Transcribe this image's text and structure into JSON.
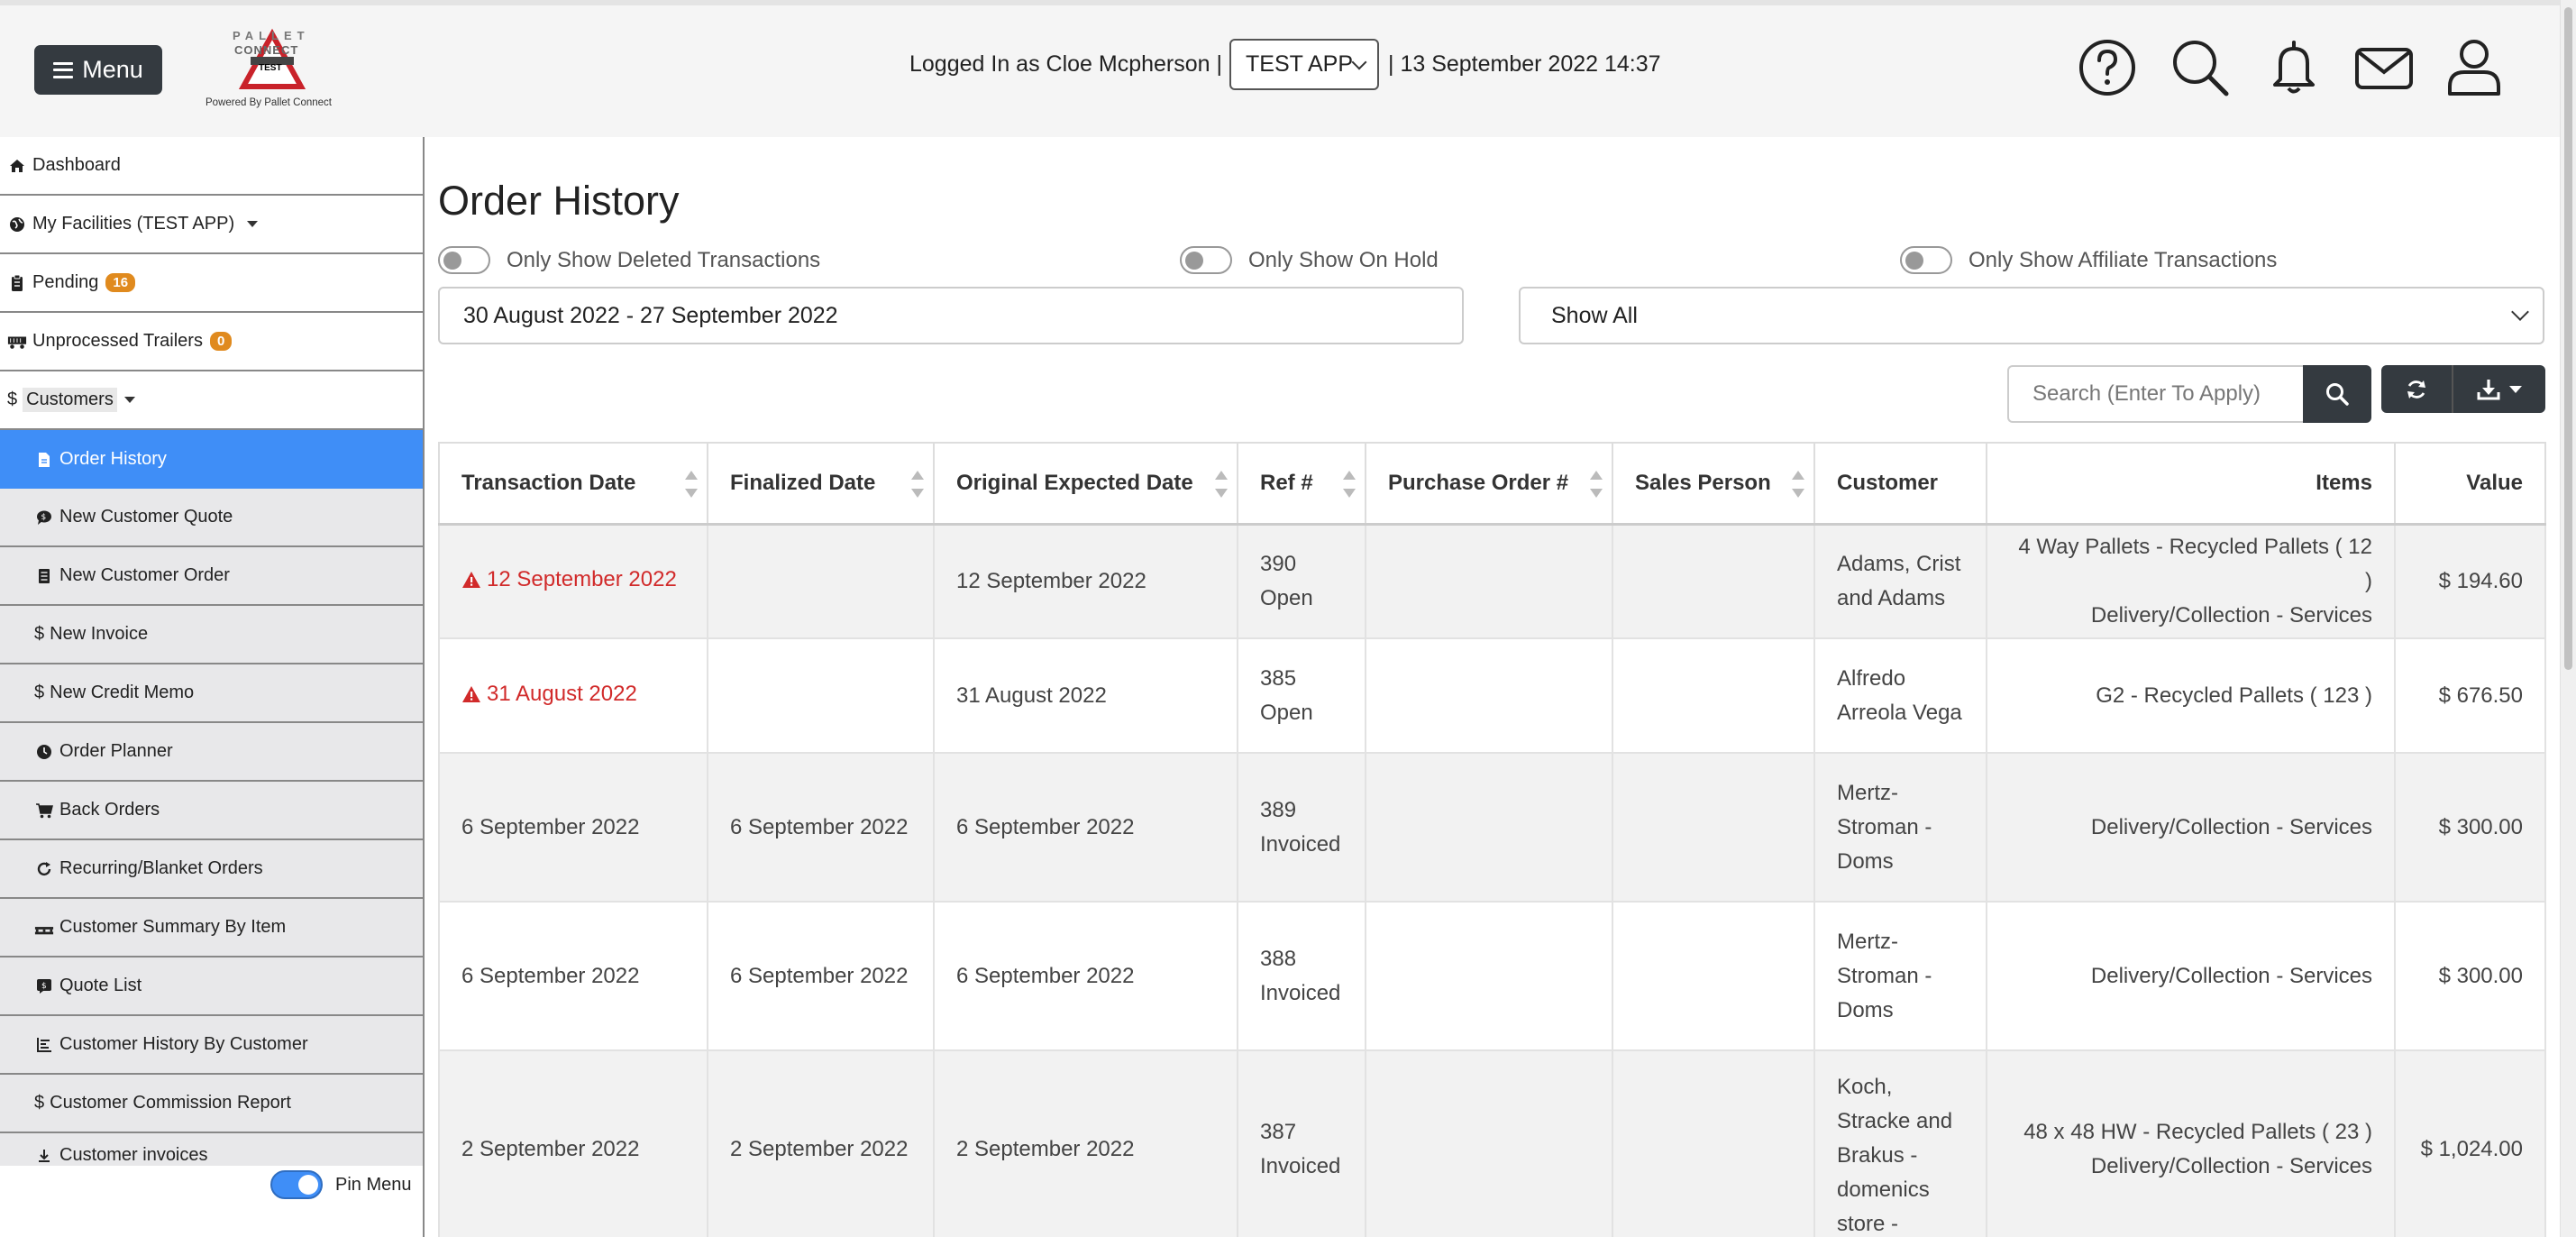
{
  "header": {
    "menu_label": "Menu",
    "logo_letters": "PALLET",
    "logo_connect": "CONNECT",
    "logo_test": "TEST",
    "powered_by": "Powered By Pallet Connect",
    "logged_in_text": "Logged In as Cloe Mcpherson |",
    "app_selected": "TEST APP",
    "datetime_text": "| 13 September 2022 14:37"
  },
  "sidebar": {
    "items": [
      {
        "label": "Dashboard",
        "icon": "home-icon"
      },
      {
        "label": "My Facilities (TEST APP)",
        "icon": "globe-icon"
      },
      {
        "label": "Pending",
        "icon": "clipboard-icon",
        "badge": "16"
      },
      {
        "label": "Unprocessed Trailers",
        "icon": "truck-icon",
        "badge": "0"
      },
      {
        "label": "Customers",
        "icon": "dollar-icon"
      }
    ],
    "sub_items": [
      {
        "label": "Order History",
        "icon": "file-icon",
        "active": true
      },
      {
        "label": "New Customer Quote",
        "icon": "comment-icon"
      },
      {
        "label": "New Customer Order",
        "icon": "list-icon"
      },
      {
        "label": "New Invoice",
        "icon": "dollar-icon"
      },
      {
        "label": "New Credit Memo",
        "icon": "dollar-icon"
      },
      {
        "label": "Order Planner",
        "icon": "clock-icon"
      },
      {
        "label": "Back Orders",
        "icon": "cart-icon"
      },
      {
        "label": "Recurring/Blanket Orders",
        "icon": "refresh-icon"
      },
      {
        "label": "Customer Summary By Item",
        "icon": "pallet-icon"
      },
      {
        "label": "Quote List",
        "icon": "quote-icon"
      },
      {
        "label": "Customer History By Customer",
        "icon": "chart-icon"
      },
      {
        "label": "Customer Commission Report",
        "icon": "dollar-icon"
      },
      {
        "label": "Customer invoices",
        "icon": "download-icon"
      }
    ],
    "pin_menu_label": "Pin Menu"
  },
  "main": {
    "title": "Order History",
    "filters": {
      "deleted": "Only Show Deleted Transactions",
      "on_hold": "Only Show On Hold",
      "affiliate": "Only Show Affiliate Transactions"
    },
    "date_range": "30 August 2022 - 27 September 2022",
    "show_select": "Show All",
    "search_placeholder": "Search (Enter To Apply)"
  },
  "table": {
    "headers": [
      "Transaction Date",
      "Finalized Date",
      "Original Expected Date",
      "Ref #",
      "Purchase Order #",
      "Sales Person",
      "Customer",
      "Items",
      "Value"
    ],
    "rows": [
      {
        "transaction_date": "12 September 2022",
        "warning": true,
        "finalized_date": "",
        "original_expected_date": "12 September 2022",
        "ref": "390",
        "status": "Open",
        "purchase_order": "",
        "sales_person": "",
        "customer": [
          "Adams, Crist",
          "and Adams"
        ],
        "items": [
          "4 Way Pallets - Recycled Pallets ( 12 )",
          "Delivery/Collection - Services"
        ],
        "value": "$ 194.60"
      },
      {
        "transaction_date": "31 August 2022",
        "warning": true,
        "finalized_date": "",
        "original_expected_date": "31 August 2022",
        "ref": "385",
        "status": "Open",
        "purchase_order": "",
        "sales_person": "",
        "customer": [
          "Alfredo",
          "Arreola Vega"
        ],
        "items": [
          "G2 - Recycled Pallets ( 123 )"
        ],
        "value": "$ 676.50"
      },
      {
        "transaction_date": "6 September 2022",
        "warning": false,
        "finalized_date": "6 September 2022",
        "original_expected_date": "6 September 2022",
        "ref": "389",
        "status": "Invoiced",
        "purchase_order": "",
        "sales_person": "",
        "customer": [
          "Mertz-",
          "Stroman -",
          "Doms"
        ],
        "items": [
          "Delivery/Collection - Services"
        ],
        "value": "$ 300.00"
      },
      {
        "transaction_date": "6 September 2022",
        "warning": false,
        "finalized_date": "6 September 2022",
        "original_expected_date": "6 September 2022",
        "ref": "388",
        "status": "Invoiced",
        "purchase_order": "",
        "sales_person": "",
        "customer": [
          "Mertz-",
          "Stroman -",
          "Doms"
        ],
        "items": [
          "Delivery/Collection - Services"
        ],
        "value": "$ 300.00"
      },
      {
        "transaction_date": "2 September 2022",
        "warning": false,
        "finalized_date": "2 September 2022",
        "original_expected_date": "2 September 2022",
        "ref": "387",
        "status": "Invoiced",
        "purchase_order": "",
        "sales_person": "",
        "customer": [
          "Koch,",
          "Stracke and",
          "Brakus -",
          "domenics",
          "store -"
        ],
        "items": [
          "48 x 48 HW - Recycled Pallets ( 23 )",
          "Delivery/Collection - Services"
        ],
        "value": "$ 1,024.00"
      }
    ]
  },
  "colors": {
    "accent": "#3f8ef7",
    "dark_button": "#343a40",
    "warning_red": "#d12a2a",
    "badge_orange": "#e08a1e"
  }
}
